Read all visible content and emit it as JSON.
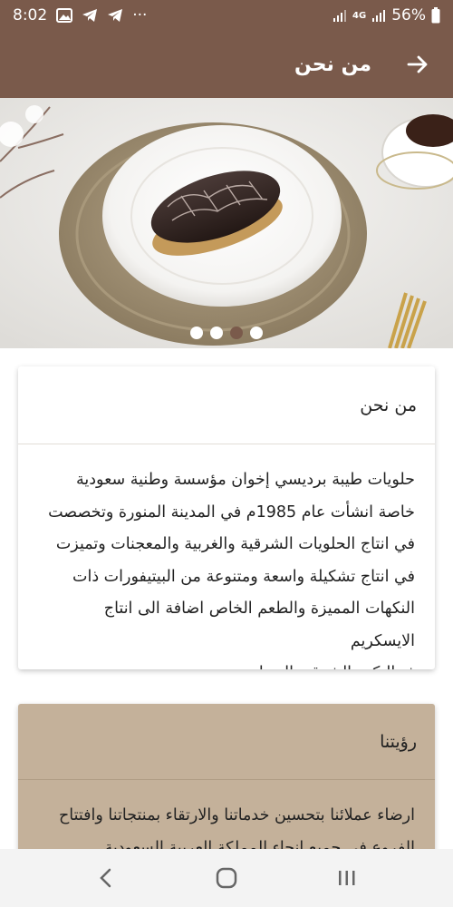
{
  "status_bar": {
    "time": "8:02",
    "dots": "···",
    "network": "4G",
    "battery": "56%"
  },
  "app_bar": {
    "title": "من نحن",
    "back_icon": "arrow-right-icon"
  },
  "hero": {
    "slide_count": 4,
    "active_slide_index": 2
  },
  "about_card": {
    "title": "من نحن",
    "lines": [
      "حلويات طيبة برديسي إخوان مؤسسة وطنية سعودية",
      "خاصة انشأت عام 1985م في المدينة المنورة وتخصصت",
      "في انتاج الحلويات الشرقية والغربية والمعجنات وتميزت",
      "في انتاج تشكيلة واسعة ومتنوعة من البيتيفورات ذات",
      "النكهات المميزة والطعم الخاص اضافة الى انتاج الايسكريم",
      "ذو النكهة الشرقية الحجازية."
    ]
  },
  "vision_card": {
    "title": "رؤيتنا",
    "lines": [
      "ارضاء عملائنا بتحسين خدماتنا والارتقاء بمنتجاتنا وافتتاح",
      "الفروع في جميع انحاء المملكة العربية السعودية"
    ]
  },
  "nav_bar": {
    "recents_icon": "recents-icon",
    "home_icon": "home-icon",
    "back_icon": "back-chevron-icon"
  },
  "colors": {
    "primary": "#7a5a4b",
    "vision_card_bg": "#c4b19a"
  }
}
